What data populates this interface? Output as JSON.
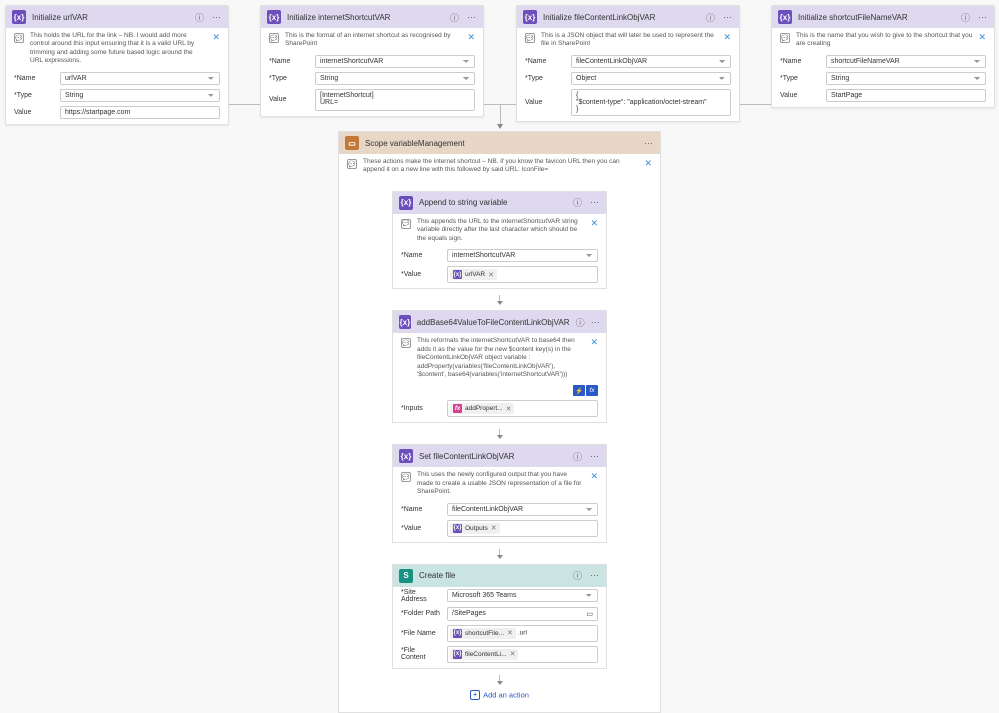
{
  "c1": {
    "title": "Initialize urlVAR",
    "note": "This holds the URL for the link – NB. I would add more control around this input ensuring that it is a valid URL by trimming and adding some future based logic around the URL expressions.",
    "name": "urlVAR",
    "type": "String",
    "value": "https://startpage.com"
  },
  "c2": {
    "title": "Initialize internetShortcutVAR",
    "note": "This is the format of an internet shortcut as recognised by SharePoint",
    "name": "internetShortcutVAR",
    "type": "String",
    "value": "[InternetShortcut]\nURL="
  },
  "c3": {
    "title": "Initialize fileContentLinkObjVAR",
    "note": "This is a JSON object that will later be used to represent the file in SharePoint",
    "name": "fileContentLinkObjVAR",
    "type": "Object",
    "value": "{\n  \"$content-type\": \"application/octet-stream\"\n}"
  },
  "c4": {
    "title": "Initialize shortcutFileNameVAR",
    "note": "This is the name that you wish to give to the shortcut that you are creating",
    "name": "shortcutFileNameVAR",
    "type": "String",
    "value": "StartPage"
  },
  "scope": {
    "title": "Scope variableManagement",
    "note": "These actions make the internet shortcut – NB. if you know the favicon URL then you can append it on a new line with this followed by said URL: IconFile="
  },
  "a1": {
    "title": "Append to string variable",
    "note": "This appends the URL to the internetShortcutVAR string variable directly after the last character which should be the equals sign.",
    "name": "internetShortcutVAR",
    "tok": "urlVAR"
  },
  "a2": {
    "title": "addBase64ValueToFileContentLinkObjVAR",
    "note": "This reformats the internetShortcutVAR to base64 then adds it as the value for the new $content key(s) in the fileContentLinkObjVAR object variable :\naddProperty(variables('fileContentLinkObjVAR'), '$content', base64(variables('internetShortcutVAR')))",
    "tok": "addPropert..."
  },
  "a3": {
    "title": "Set fileContentLinkObjVAR",
    "note": "This uses the newly configured output that you have made to create a usable JSON representation of a file for SharePoint.",
    "name": "fileContentLinkObjVAR",
    "tok": "Outputs"
  },
  "a4": {
    "title": "Create file",
    "site": "Microsoft 365 Teams",
    "folder": "/SitePages",
    "f1": "shortcutFile...",
    "suffix": ".url",
    "f2": "fileContentLi..."
  },
  "lbl": {
    "name": "*Name",
    "type": "*Type",
    "value": "Value",
    "val2": "*Value",
    "inputs": "*Inputs",
    "site": "*Site Address",
    "folder": "*Folder Path",
    "fname": "*File Name",
    "fcontent": "*File Content"
  },
  "add": "Add an action"
}
